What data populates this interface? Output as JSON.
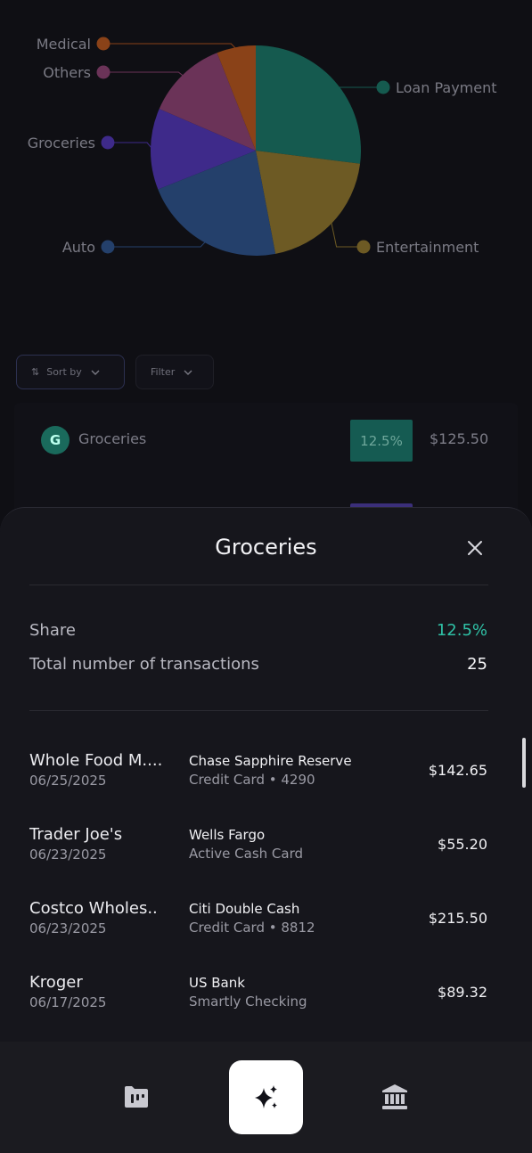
{
  "chart_data": {
    "type": "pie",
    "title": "",
    "slices": [
      {
        "label": "Loan Payment",
        "value": 27,
        "color": "#155a4f"
      },
      {
        "label": "Entertainment",
        "value": 20,
        "color": "#6d5a24"
      },
      {
        "label": "Auto",
        "value": 22,
        "color": "#24406b"
      },
      {
        "label": "Groceries",
        "value": 12.5,
        "color": "#3e2a8a"
      },
      {
        "label": "Others",
        "value": 12.5,
        "color": "#6b3358"
      },
      {
        "label": "Medical",
        "value": 6,
        "color": "#8a4218"
      }
    ],
    "legend": "callout-labels"
  },
  "controls": {
    "sort_label": "Sort by",
    "filter_label": "Filter"
  },
  "background_row": {
    "avatar_letter": "G",
    "name": "Groceries",
    "share": "12.5%",
    "amount": "$125.50"
  },
  "sheet": {
    "title": "Groceries",
    "share_label": "Share",
    "share_value": "12.5%",
    "count_label": "Total number of transactions",
    "count_value": "25",
    "transactions": [
      {
        "merchant": "Whole Food M....",
        "date": "06/25/2025",
        "bank": "Chase Sapphire Reserve",
        "card": "Credit Card • 4290",
        "amount": "$142.65"
      },
      {
        "merchant": "Trader Joe's",
        "date": "06/23/2025",
        "bank": "Wells Fargo",
        "card": "Active Cash Card",
        "amount": "$55.20"
      },
      {
        "merchant": "Costco Wholes..",
        "date": "06/23/2025",
        "bank": "Citi Double Cash",
        "card": "Credit Card • 8812",
        "amount": "$215.50"
      },
      {
        "merchant": "Kroger",
        "date": "06/17/2025",
        "bank": "US Bank",
        "card": "Smartly Checking",
        "amount": "$89.32"
      }
    ]
  },
  "nav": {
    "items": [
      "dashboard-icon",
      "sparkles-icon",
      "bank-icon"
    ]
  }
}
